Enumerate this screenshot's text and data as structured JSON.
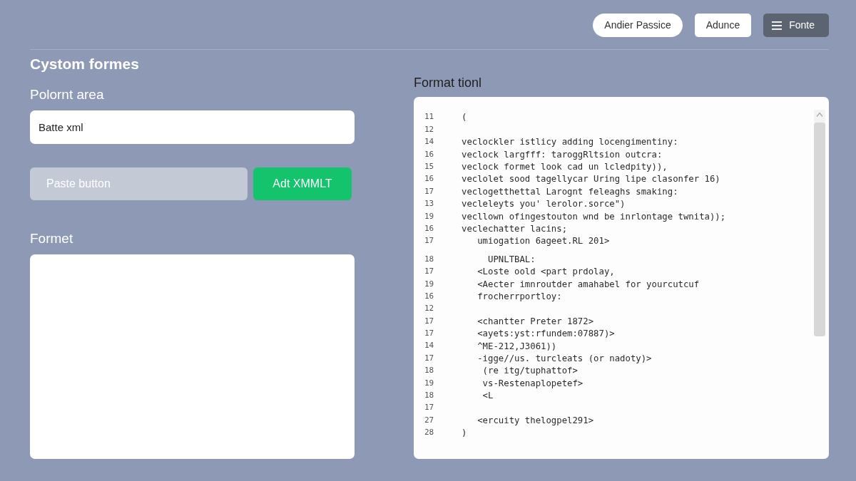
{
  "header": {
    "buttons": [
      {
        "label": "Andier Passice",
        "kind": "pill"
      },
      {
        "label": "Adunce",
        "kind": "plain"
      },
      {
        "label": "Fonte",
        "kind": "menu"
      }
    ]
  },
  "form_panel": {
    "title": "Cystom formes",
    "input_label": "Polornt area",
    "input": {
      "value": "Batte xml"
    },
    "buttons": [
      {
        "label": "Paste button",
        "kind": "muted"
      },
      {
        "label": "Adt XMMLT",
        "kind": "success"
      }
    ],
    "output_label": "Formet"
  },
  "code_panel": {
    "title": "Format tionl",
    "blocks": [
      {
        "lines": [
          {
            "number": "11",
            "text": "("
          },
          {
            "number": "12"
          },
          {
            "number": "14",
            "text": "veclockler istlicy adding locengimentiny:"
          },
          {
            "number": "16",
            "text": "veclock largfff: taroggRltsion outcra:"
          },
          {
            "number": "15",
            "text": "veclock formet look cad un lcledpity)),"
          },
          {
            "number": "16",
            "text": "veclolet sood tagellycar Uring lipe clasonfer 16)"
          },
          {
            "number": "17",
            "text": "veclogetthettal Larognt feleaghs smaking:"
          },
          {
            "number": "13",
            "text": "vecleleyts you' lerolor.sorce\")"
          },
          {
            "number": "19",
            "text": "vecllown ofingestouton wnd be inrlontage twnita));"
          },
          {
            "number": "16",
            "text": "veclechatter lacins;"
          },
          {
            "number": "17",
            "text": "   umiogation 6ageet.RL 201>"
          }
        ]
      },
      {
        "lines": [
          {
            "number": "18",
            "text": "     UPNLTBAL:"
          },
          {
            "number": "17",
            "text": "   <Loste oold <part prdolay,"
          },
          {
            "number": "19",
            "text": "   <Aecter imnroutder amahabel for yourcutcuf"
          },
          {
            "number": "16",
            "text": "   frocherrportloy:"
          },
          {
            "number": "12"
          },
          {
            "number": "17",
            "text": "   <chantter Preter 1872>"
          },
          {
            "number": "17",
            "text": "   <ayets:yst:rfundem:07887)>"
          },
          {
            "number": "14",
            "text": "   ^ME-212,J3061))"
          },
          {
            "number": "17",
            "text": "   -igge//us. turcleats (or nadoty)>"
          },
          {
            "number": "18",
            "text": "    (re itg/tuphattof>"
          },
          {
            "number": "19",
            "text": "    vs-Restenaplopetef>"
          },
          {
            "number": "18",
            "text": "    <L"
          },
          {
            "number": "17"
          },
          {
            "number": "27",
            "text": "   <ercuity thelogpel291>"
          },
          {
            "number": "28",
            "text": ")"
          }
        ]
      }
    ]
  }
}
